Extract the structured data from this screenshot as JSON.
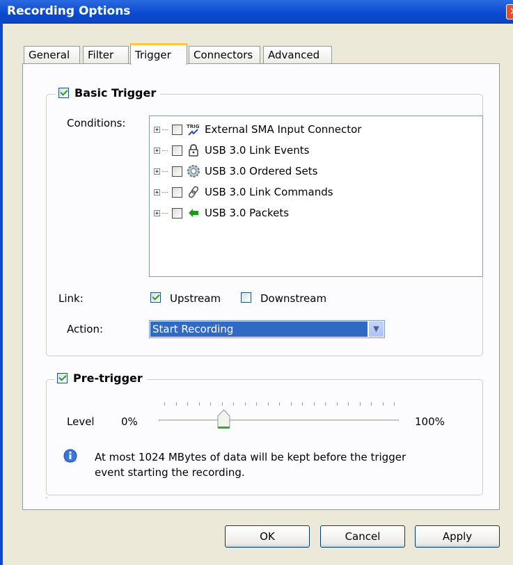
{
  "window": {
    "title": "Recording Options"
  },
  "tabs": [
    "General",
    "Filter",
    "Trigger",
    "Connectors",
    "Advanced"
  ],
  "active_tab": "Trigger",
  "basic_trigger": {
    "label": "Basic Trigger",
    "checked": true,
    "conditions_label": "Conditions:",
    "conditions": [
      {
        "label": "External SMA Input Connector",
        "icon": "trig-icon"
      },
      {
        "label": "USB 3.0 Link Events",
        "icon": "lock-icon"
      },
      {
        "label": "USB 3.0 Ordered Sets",
        "icon": "gear-icon"
      },
      {
        "label": "USB 3.0 Link Commands",
        "icon": "chain-link-icon"
      },
      {
        "label": "USB 3.0 Packets",
        "icon": "green-arrow-icon"
      }
    ],
    "link_label": "Link:",
    "upstream_label": "Upstream",
    "upstream_checked": true,
    "downstream_label": "Downstream",
    "downstream_checked": false,
    "action_label": "Action:",
    "action_value": "Start Recording"
  },
  "pretrigger": {
    "label": "Pre-trigger",
    "checked": true,
    "level_label": "Level",
    "min_label": "0%",
    "max_label": "100%",
    "level_fraction": 0.27,
    "info_text_line1": "At most 1024 MBytes of data will be kept before the trigger",
    "info_text_line2": "event starting the recording."
  },
  "buttons": {
    "ok": "OK",
    "cancel": "Cancel",
    "apply": "Apply"
  }
}
